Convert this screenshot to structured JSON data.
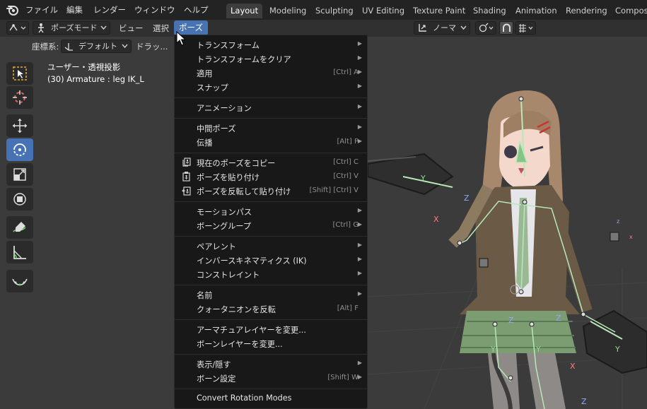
{
  "top_menu": [
    "ファイル",
    "編集",
    "レンダー",
    "ウィンドウ",
    "ヘルプ"
  ],
  "workspace_tabs": [
    {
      "label": "Layout",
      "active": true
    },
    {
      "label": "Modeling",
      "active": false
    },
    {
      "label": "Sculpting",
      "active": false
    },
    {
      "label": "UV Editing",
      "active": false
    },
    {
      "label": "Texture Paint",
      "active": false
    },
    {
      "label": "Shading",
      "active": false
    },
    {
      "label": "Animation",
      "active": false
    },
    {
      "label": "Rendering",
      "active": false
    },
    {
      "label": "Composit",
      "active": false
    }
  ],
  "header": {
    "mode_label": "ポーズモード",
    "view_label": "ビュー",
    "select_label": "選択",
    "pose_label": "ポーズ",
    "orientation_label": "ノーマ"
  },
  "subheader": {
    "coord_label": "座標系:",
    "coord_value": "デフォルト",
    "drag_label": "ドラッ..."
  },
  "viewport": {
    "view_name": "ユーザー・透視投影",
    "object_info": "(30) Armature : leg IK_L"
  },
  "pose_menu": {
    "items": [
      {
        "label": "トランスフォーム",
        "shortcut": "",
        "submenu": true,
        "icon": ""
      },
      {
        "label": "トランスフォームをクリア",
        "shortcut": "",
        "submenu": true,
        "icon": ""
      },
      {
        "label": "適用",
        "shortcut": "[Ctrl] A",
        "submenu": true,
        "icon": ""
      },
      {
        "label": "スナップ",
        "shortcut": "",
        "submenu": true,
        "icon": ""
      },
      {
        "label": "アニメーション",
        "shortcut": "",
        "submenu": true,
        "icon": ""
      },
      {
        "label": "中間ポーズ",
        "shortcut": "",
        "submenu": true,
        "icon": ""
      },
      {
        "label": "伝播",
        "shortcut": "[Alt] P",
        "submenu": true,
        "icon": ""
      },
      {
        "label": "現在のポーズをコピー",
        "shortcut": "[Ctrl] C",
        "submenu": false,
        "icon": "copy-pose-icon"
      },
      {
        "label": "ポーズを貼り付け",
        "shortcut": "[Ctrl] V",
        "submenu": false,
        "icon": "paste-pose-icon"
      },
      {
        "label": "ポーズを反転して貼り付け",
        "shortcut": "[Shift] [Ctrl] V",
        "submenu": false,
        "icon": "paste-flipped-pose-icon"
      },
      {
        "label": "モーションパス",
        "shortcut": "",
        "submenu": true,
        "icon": ""
      },
      {
        "label": "ボーングループ",
        "shortcut": "[Ctrl] G",
        "submenu": true,
        "icon": ""
      },
      {
        "label": "ペアレント",
        "shortcut": "",
        "submenu": true,
        "icon": ""
      },
      {
        "label": "インバースキネマティクス (IK)",
        "shortcut": "",
        "submenu": true,
        "icon": ""
      },
      {
        "label": "コンストレイント",
        "shortcut": "",
        "submenu": true,
        "icon": ""
      },
      {
        "label": "名前",
        "shortcut": "",
        "submenu": true,
        "icon": ""
      },
      {
        "label": "クォータニオンを反転",
        "shortcut": "[Alt] F",
        "submenu": false,
        "icon": ""
      },
      {
        "label": "アーマチュアレイヤーを変更...",
        "shortcut": "",
        "submenu": false,
        "icon": ""
      },
      {
        "label": "ボーンレイヤーを変更...",
        "shortcut": "",
        "submenu": false,
        "icon": ""
      },
      {
        "label": "表示/隠す",
        "shortcut": "",
        "submenu": true,
        "icon": ""
      },
      {
        "label": "ボーン設定",
        "shortcut": "[Shift] W",
        "submenu": true,
        "icon": ""
      },
      {
        "label": "Convert Rotation Modes",
        "shortcut": "",
        "submenu": false,
        "icon": ""
      }
    ]
  },
  "colors": {
    "accent": "#4772b3",
    "menu_bg": "#181818",
    "topbar_bg": "#232323",
    "viewport_bg": "#3b3b3b"
  }
}
